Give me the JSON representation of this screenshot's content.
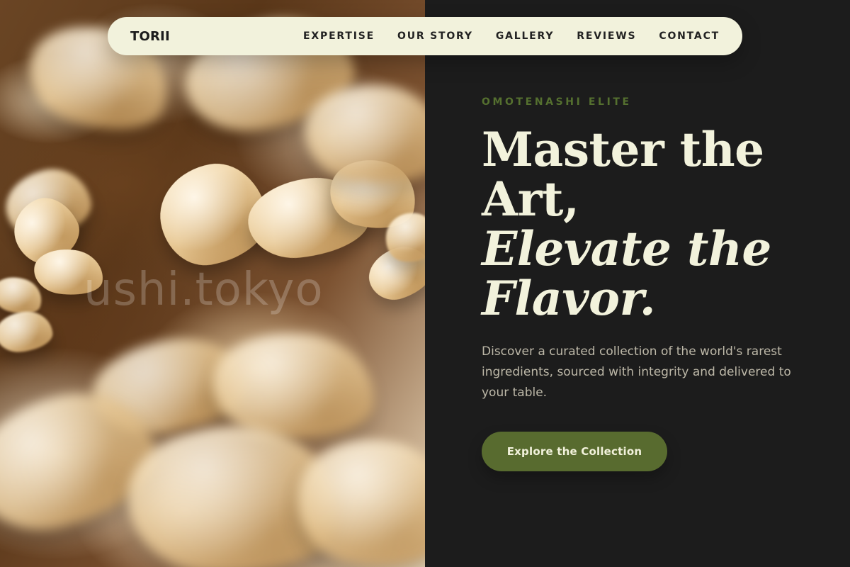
{
  "brand": "TORII",
  "nav": {
    "links": [
      "EXPERTISE",
      "OUR STORY",
      "GALLERY",
      "REVIEWS",
      "CONTACT"
    ]
  },
  "photo": {
    "watermark": "ushi.tokyo"
  },
  "hero": {
    "eyebrow": "OMOTENASHI ELITE",
    "headline": {
      "line1": "Master the",
      "line2": "Art,",
      "line3": "Elevate the",
      "line4": "Flavor."
    },
    "description": "Discover a curated collection of the world's rarest ingredients, sourced with integrity and delivered to your table.",
    "cta_label": "Explore the Collection"
  },
  "colors": {
    "dark_bg": "#1c1c1c",
    "cream": "#f2f2dc",
    "accent_green": "#586b2f",
    "eyebrow_green": "#55702f",
    "muted_text": "#bdb8a8"
  },
  "icons": []
}
